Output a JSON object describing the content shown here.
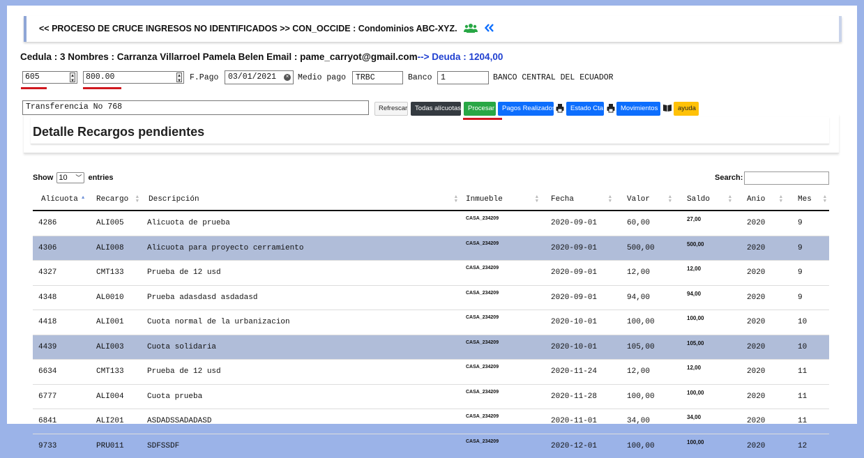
{
  "header": {
    "title": "<< PROCESO DE CRUCE INGRESOS NO IDENTIFICADOS >> CON_OCCIDE : Condominios ABC-XYZ.",
    "icons": [
      "users-icon",
      "double-chevron-left-icon"
    ]
  },
  "client": {
    "line_main": "Cedula : 3 Nombres : Carranza Villarroel Pamela Belen Email : pame_carryot@gmail.com",
    "arrow": "-->",
    "deuda": "Deuda : 1204,00"
  },
  "form": {
    "field1_value": "605",
    "field2_value": "800.00",
    "fpago_label": "F.Pago",
    "fpago_value": "03/01/2021",
    "medio_label": "Medio pago",
    "medio_value": "TRBC",
    "banco_label": "Banco",
    "banco_value": "1",
    "banco_name": "BANCO CENTRAL DEL ECUADOR",
    "referencia_value": "Transferencia No 768"
  },
  "buttons": {
    "refrescar": "Refrescar",
    "todas": "Todas alícuotas",
    "procesar": "Procesar",
    "pagos": "Pagos Realizados",
    "estado": "Estado Cta",
    "movimientos": "Movimientos",
    "ayuda": "ayuda"
  },
  "colors": {
    "accent_blue": "#0d6efd",
    "green": "#28a745",
    "dark": "#343a40",
    "yellow": "#ffc107",
    "highlight_row": "#b0bdd9",
    "red_marker": "#d0181f"
  },
  "panel": {
    "title": "Detalle Recargos pendientes"
  },
  "table_controls": {
    "show_label": "Show",
    "entries_value": "10",
    "entries_label": "entries",
    "search_label": "Search:"
  },
  "table": {
    "headers": [
      "Alícuota",
      "Recargo",
      "Descripción",
      "Inmueble",
      "Fecha",
      "Valor",
      "Saldo",
      "Anio",
      "Mes"
    ],
    "rows": [
      {
        "c": [
          "4286",
          "ALI005",
          "Alicuota de prueba",
          "CASA_234209",
          "2020-09-01",
          "60,00",
          "27,00",
          "2020",
          "9"
        ]
      },
      {
        "c": [
          "4306",
          "ALI008",
          "Alicuota para proyecto cerramiento",
          "CASA_234209",
          "2020-09-01",
          "500,00",
          "500,00",
          "2020",
          "9"
        ]
      },
      {
        "c": [
          "4327",
          "CMT133",
          "Prueba de 12 usd",
          "CASA_234209",
          "2020-09-01",
          "12,00",
          "12,00",
          "2020",
          "9"
        ]
      },
      {
        "c": [
          "4348",
          "AL0010",
          "Prueba adasdasd asdadasd",
          "CASA_234209",
          "2020-09-01",
          "94,00",
          "94,00",
          "2020",
          "9"
        ]
      },
      {
        "c": [
          "4418",
          "ALI001",
          "Cuota normal de la urbanizacion",
          "CASA_234209",
          "2020-10-01",
          "100,00",
          "100,00",
          "2020",
          "10"
        ]
      },
      {
        "c": [
          "4439",
          "ALI003",
          "Cuota solidaria",
          "CASA_234209",
          "2020-10-01",
          "105,00",
          "105,00",
          "2020",
          "10"
        ]
      },
      {
        "c": [
          "6634",
          "CMT133",
          "Prueba de 12 usd",
          "CASA_234209",
          "2020-11-24",
          "12,00",
          "12,00",
          "2020",
          "11"
        ]
      },
      {
        "c": [
          "6777",
          "ALI004",
          "Cuota prueba",
          "CASA_234209",
          "2020-11-28",
          "100,00",
          "100,00",
          "2020",
          "11"
        ]
      },
      {
        "c": [
          "6841",
          "ALI201",
          "ASDADSSADADASD",
          "CASA_234209",
          "2020-11-01",
          "34,00",
          "34,00",
          "2020",
          "11"
        ]
      },
      {
        "c": [
          "9733",
          "PRU011",
          "SDFSSDF",
          "CASA_234209",
          "2020-12-01",
          "100,00",
          "100,00",
          "2020",
          "12"
        ]
      }
    ]
  }
}
